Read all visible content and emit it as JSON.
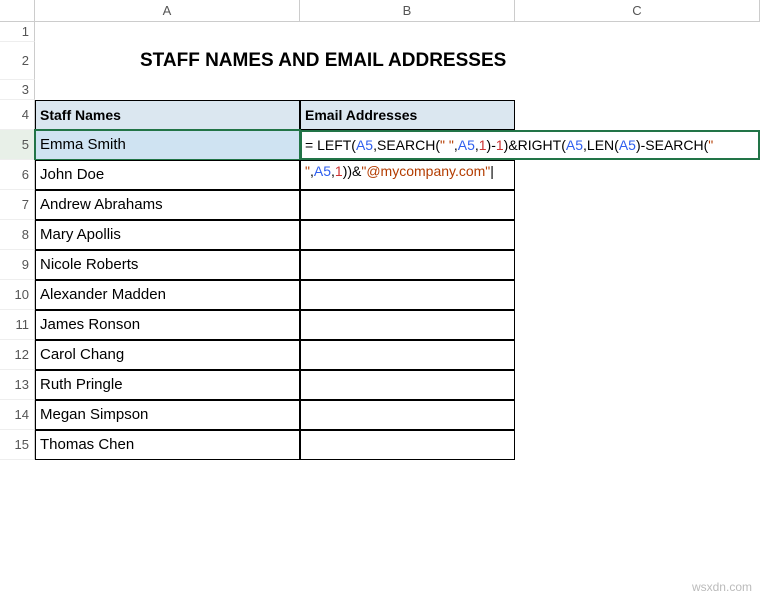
{
  "columns": {
    "a": "A",
    "b": "B",
    "c": "C"
  },
  "title": "STAFF NAMES AND EMAIL ADDRESSES",
  "headers": {
    "names": "Staff Names",
    "emails": "Email Addresses"
  },
  "rows": {
    "1": "1",
    "2": "2",
    "3": "3",
    "4": "4",
    "5": "5",
    "6": "6",
    "7": "7",
    "8": "8",
    "9": "9",
    "10": "10",
    "11": "11",
    "12": "12",
    "13": "13",
    "14": "14",
    "15": "15"
  },
  "staff": [
    "Emma Smith",
    "John Doe",
    "Andrew Abrahams",
    "Mary Apollis",
    "Nicole Roberts",
    "Alexander Madden",
    "James Ronson",
    "Carol Chang",
    "Ruth Pringle",
    "Megan Simpson",
    "Thomas Chen"
  ],
  "formula": {
    "eq": "= ",
    "p1": "LEFT(",
    "ref1": "A5",
    "p2": ",SEARCH(",
    "str1": "\" \"",
    "p3": ",",
    "ref2": "A5",
    "p4": ",",
    "num1": "1",
    "p5": ")-",
    "num2": "1",
    "p6": ")&RIGHT(",
    "ref3": "A5",
    "p7": ",LEN(",
    "ref4": "A5",
    "p8": ")-SEARCH(",
    "str2": "\" \"",
    "p9": ",",
    "ref5": "A5",
    "p10": ",",
    "num3": "1",
    "p11": "))&",
    "str3": "\"@mycompany.com\"",
    "cursor": "|"
  },
  "watermark": "wsxdn.com"
}
